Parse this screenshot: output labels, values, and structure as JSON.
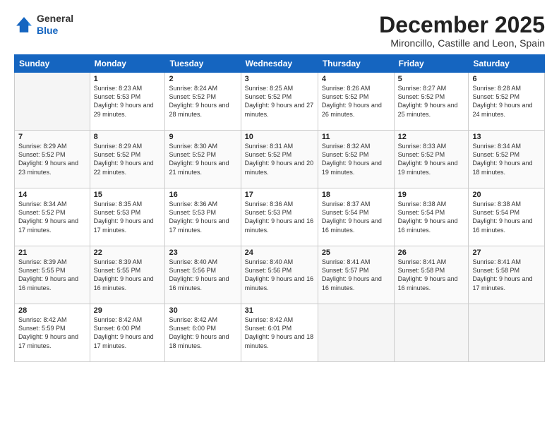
{
  "logo": {
    "line1": "General",
    "line2": "Blue"
  },
  "title": "December 2025",
  "subtitle": "Mironcillo, Castille and Leon, Spain",
  "weekdays": [
    "Sunday",
    "Monday",
    "Tuesday",
    "Wednesday",
    "Thursday",
    "Friday",
    "Saturday"
  ],
  "weeks": [
    [
      {
        "day": "",
        "sunrise": "",
        "sunset": "",
        "daylight": ""
      },
      {
        "day": "1",
        "sunrise": "Sunrise: 8:23 AM",
        "sunset": "Sunset: 5:53 PM",
        "daylight": "Daylight: 9 hours and 29 minutes."
      },
      {
        "day": "2",
        "sunrise": "Sunrise: 8:24 AM",
        "sunset": "Sunset: 5:52 PM",
        "daylight": "Daylight: 9 hours and 28 minutes."
      },
      {
        "day": "3",
        "sunrise": "Sunrise: 8:25 AM",
        "sunset": "Sunset: 5:52 PM",
        "daylight": "Daylight: 9 hours and 27 minutes."
      },
      {
        "day": "4",
        "sunrise": "Sunrise: 8:26 AM",
        "sunset": "Sunset: 5:52 PM",
        "daylight": "Daylight: 9 hours and 26 minutes."
      },
      {
        "day": "5",
        "sunrise": "Sunrise: 8:27 AM",
        "sunset": "Sunset: 5:52 PM",
        "daylight": "Daylight: 9 hours and 25 minutes."
      },
      {
        "day": "6",
        "sunrise": "Sunrise: 8:28 AM",
        "sunset": "Sunset: 5:52 PM",
        "daylight": "Daylight: 9 hours and 24 minutes."
      }
    ],
    [
      {
        "day": "7",
        "sunrise": "Sunrise: 8:29 AM",
        "sunset": "Sunset: 5:52 PM",
        "daylight": "Daylight: 9 hours and 23 minutes."
      },
      {
        "day": "8",
        "sunrise": "Sunrise: 8:29 AM",
        "sunset": "Sunset: 5:52 PM",
        "daylight": "Daylight: 9 hours and 22 minutes."
      },
      {
        "day": "9",
        "sunrise": "Sunrise: 8:30 AM",
        "sunset": "Sunset: 5:52 PM",
        "daylight": "Daylight: 9 hours and 21 minutes."
      },
      {
        "day": "10",
        "sunrise": "Sunrise: 8:31 AM",
        "sunset": "Sunset: 5:52 PM",
        "daylight": "Daylight: 9 hours and 20 minutes."
      },
      {
        "day": "11",
        "sunrise": "Sunrise: 8:32 AM",
        "sunset": "Sunset: 5:52 PM",
        "daylight": "Daylight: 9 hours and 19 minutes."
      },
      {
        "day": "12",
        "sunrise": "Sunrise: 8:33 AM",
        "sunset": "Sunset: 5:52 PM",
        "daylight": "Daylight: 9 hours and 19 minutes."
      },
      {
        "day": "13",
        "sunrise": "Sunrise: 8:34 AM",
        "sunset": "Sunset: 5:52 PM",
        "daylight": "Daylight: 9 hours and 18 minutes."
      }
    ],
    [
      {
        "day": "14",
        "sunrise": "Sunrise: 8:34 AM",
        "sunset": "Sunset: 5:52 PM",
        "daylight": "Daylight: 9 hours and 17 minutes."
      },
      {
        "day": "15",
        "sunrise": "Sunrise: 8:35 AM",
        "sunset": "Sunset: 5:53 PM",
        "daylight": "Daylight: 9 hours and 17 minutes."
      },
      {
        "day": "16",
        "sunrise": "Sunrise: 8:36 AM",
        "sunset": "Sunset: 5:53 PM",
        "daylight": "Daylight: 9 hours and 17 minutes."
      },
      {
        "day": "17",
        "sunrise": "Sunrise: 8:36 AM",
        "sunset": "Sunset: 5:53 PM",
        "daylight": "Daylight: 9 hours and 16 minutes."
      },
      {
        "day": "18",
        "sunrise": "Sunrise: 8:37 AM",
        "sunset": "Sunset: 5:54 PM",
        "daylight": "Daylight: 9 hours and 16 minutes."
      },
      {
        "day": "19",
        "sunrise": "Sunrise: 8:38 AM",
        "sunset": "Sunset: 5:54 PM",
        "daylight": "Daylight: 9 hours and 16 minutes."
      },
      {
        "day": "20",
        "sunrise": "Sunrise: 8:38 AM",
        "sunset": "Sunset: 5:54 PM",
        "daylight": "Daylight: 9 hours and 16 minutes."
      }
    ],
    [
      {
        "day": "21",
        "sunrise": "Sunrise: 8:39 AM",
        "sunset": "Sunset: 5:55 PM",
        "daylight": "Daylight: 9 hours and 16 minutes."
      },
      {
        "day": "22",
        "sunrise": "Sunrise: 8:39 AM",
        "sunset": "Sunset: 5:55 PM",
        "daylight": "Daylight: 9 hours and 16 minutes."
      },
      {
        "day": "23",
        "sunrise": "Sunrise: 8:40 AM",
        "sunset": "Sunset: 5:56 PM",
        "daylight": "Daylight: 9 hours and 16 minutes."
      },
      {
        "day": "24",
        "sunrise": "Sunrise: 8:40 AM",
        "sunset": "Sunset: 5:56 PM",
        "daylight": "Daylight: 9 hours and 16 minutes."
      },
      {
        "day": "25",
        "sunrise": "Sunrise: 8:41 AM",
        "sunset": "Sunset: 5:57 PM",
        "daylight": "Daylight: 9 hours and 16 minutes."
      },
      {
        "day": "26",
        "sunrise": "Sunrise: 8:41 AM",
        "sunset": "Sunset: 5:58 PM",
        "daylight": "Daylight: 9 hours and 16 minutes."
      },
      {
        "day": "27",
        "sunrise": "Sunrise: 8:41 AM",
        "sunset": "Sunset: 5:58 PM",
        "daylight": "Daylight: 9 hours and 17 minutes."
      }
    ],
    [
      {
        "day": "28",
        "sunrise": "Sunrise: 8:42 AM",
        "sunset": "Sunset: 5:59 PM",
        "daylight": "Daylight: 9 hours and 17 minutes."
      },
      {
        "day": "29",
        "sunrise": "Sunrise: 8:42 AM",
        "sunset": "Sunset: 6:00 PM",
        "daylight": "Daylight: 9 hours and 17 minutes."
      },
      {
        "day": "30",
        "sunrise": "Sunrise: 8:42 AM",
        "sunset": "Sunset: 6:00 PM",
        "daylight": "Daylight: 9 hours and 18 minutes."
      },
      {
        "day": "31",
        "sunrise": "Sunrise: 8:42 AM",
        "sunset": "Sunset: 6:01 PM",
        "daylight": "Daylight: 9 hours and 18 minutes."
      },
      {
        "day": "",
        "sunrise": "",
        "sunset": "",
        "daylight": ""
      },
      {
        "day": "",
        "sunrise": "",
        "sunset": "",
        "daylight": ""
      },
      {
        "day": "",
        "sunrise": "",
        "sunset": "",
        "daylight": ""
      }
    ]
  ]
}
